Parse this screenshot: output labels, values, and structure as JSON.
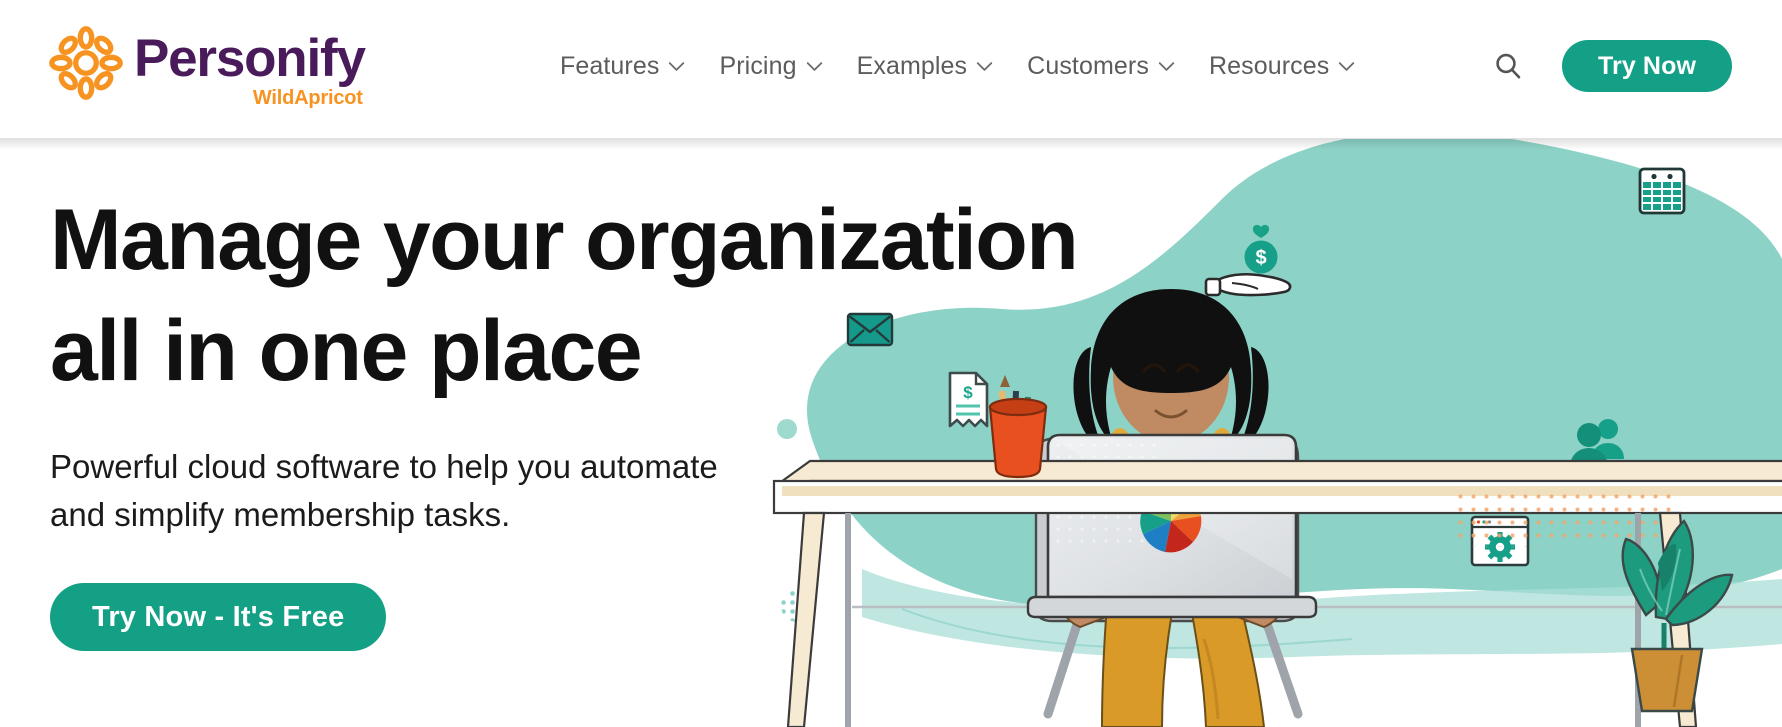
{
  "brand": {
    "name": "Personify",
    "sub": "WildApricot",
    "logo_icon": "flower-sun-icon",
    "purple": "#4A1B5B",
    "orange": "#F79321",
    "teal": "#13A086"
  },
  "header": {
    "nav": [
      {
        "label": "Features",
        "icon": "chevron-down-icon"
      },
      {
        "label": "Pricing",
        "icon": "chevron-down-icon"
      },
      {
        "label": "Examples",
        "icon": "chevron-down-icon"
      },
      {
        "label": "Customers",
        "icon": "chevron-down-icon"
      },
      {
        "label": "Resources",
        "icon": "chevron-down-icon"
      }
    ],
    "search_icon": "search-icon",
    "cta_label": "Try Now"
  },
  "hero": {
    "headline": "Manage your organization\nall in one place",
    "subhead": "Powerful cloud software to help you automate\nand simplify membership tasks.",
    "cta_label": "Try Now - It's Free",
    "illustration": {
      "alt": "Woman working at a desk on a laptop surrounded by membership-management icons",
      "blob_color": "#8DD2C6",
      "icons": [
        "envelope-icon",
        "invoice-dollar-icon",
        "hand-money-heart-icon",
        "calendar-icon",
        "people-group-icon",
        "gear-browser-icon",
        "pie-chart-sticker-icon"
      ],
      "objects": [
        "woman-figure",
        "office-chair",
        "desk",
        "laptop",
        "pencil-cup",
        "potted-plant",
        "mint-dot-accent",
        "dotted-circle-accent",
        "floor-line"
      ],
      "palette": {
        "shirt": "#E8501F",
        "skin": "#C08B63",
        "hair": "#101010",
        "pants": "#D99A28",
        "desk": "#F3E4C6",
        "laptop": "#D8DADD",
        "plant_leaf": "#1D9B7F",
        "plant_pot": "#CC8F35",
        "icon_teal": "#1A9E85"
      }
    }
  }
}
